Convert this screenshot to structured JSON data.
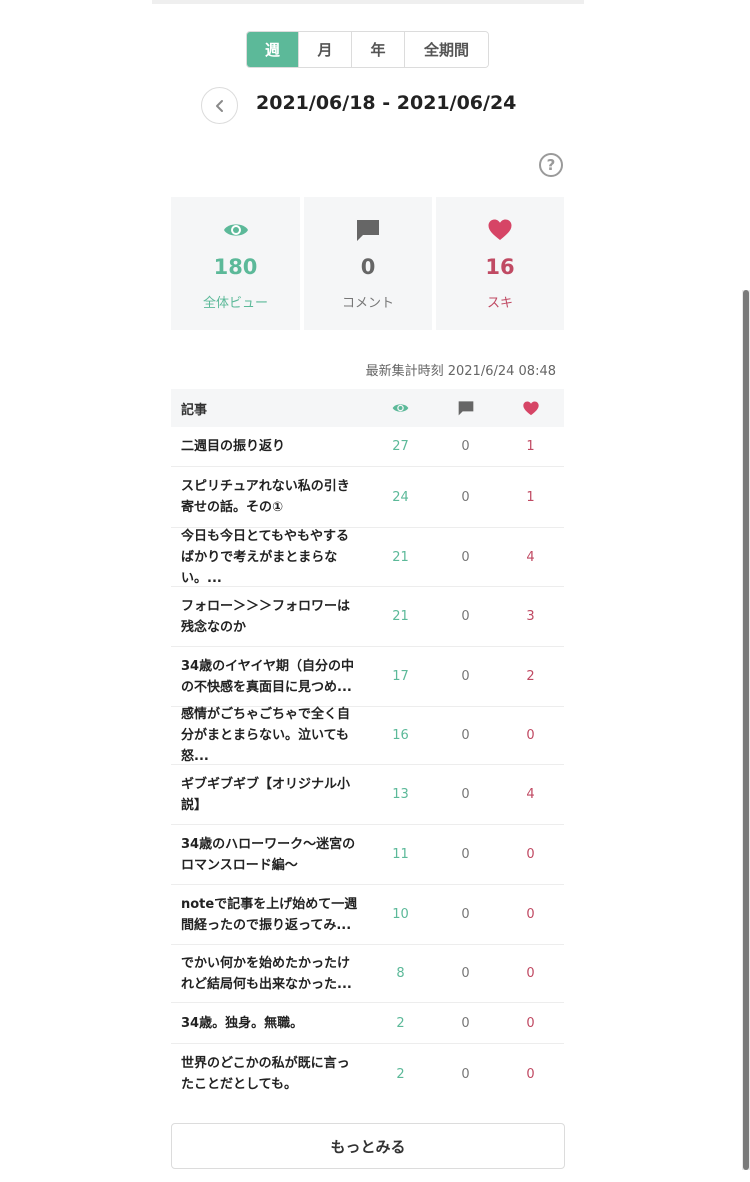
{
  "period_tabs": [
    {
      "label": "週",
      "active": true
    },
    {
      "label": "月",
      "active": false
    },
    {
      "label": "年",
      "active": false
    },
    {
      "label": "全期間",
      "active": false
    }
  ],
  "date_range": "2021/06/18 - 2021/06/24",
  "help_icon_label": "?",
  "stats": {
    "views": {
      "value": "180",
      "label": "全体ビュー",
      "color": "#5cb999"
    },
    "comments": {
      "value": "0",
      "label": "コメント",
      "color": "#666666"
    },
    "likes": {
      "value": "16",
      "label": "スキ",
      "color": "#c04a63"
    }
  },
  "updated": "最新集計時刻 2021/6/24 08:48",
  "table": {
    "header_title": "記事",
    "rows": [
      {
        "title": "二週目の振り返り",
        "views": "27",
        "comments": "0",
        "likes": "1"
      },
      {
        "title": "スピリチュアれない私の引き寄せの話。その①",
        "views": "24",
        "comments": "0",
        "likes": "1"
      },
      {
        "title": "今日も今日とてもやもやするばかりで考えがまとまらない。...",
        "views": "21",
        "comments": "0",
        "likes": "4"
      },
      {
        "title": "フォロー＞＞＞フォロワーは残念なのか",
        "views": "21",
        "comments": "0",
        "likes": "3"
      },
      {
        "title": "34歳のイヤイヤ期（自分の中の不快感を真面目に見つめ...",
        "views": "17",
        "comments": "0",
        "likes": "2"
      },
      {
        "title": "感情がごちゃごちゃで全く自分がまとまらない。泣いても怒...",
        "views": "16",
        "comments": "0",
        "likes": "0"
      },
      {
        "title": "ギブギブギブ【オリジナル小説】",
        "views": "13",
        "comments": "0",
        "likes": "4"
      },
      {
        "title": "34歳のハローワーク〜迷宮のロマンスロード編〜",
        "views": "11",
        "comments": "0",
        "likes": "0"
      },
      {
        "title": "noteで記事を上げ始めて一週間経ったので振り返ってみ...",
        "views": "10",
        "comments": "0",
        "likes": "0"
      },
      {
        "title": "でかい何かを始めたかったけれど結局何も出来なかった...",
        "views": "8",
        "comments": "0",
        "likes": "0"
      },
      {
        "title": "34歳。独身。無職。",
        "views": "2",
        "comments": "0",
        "likes": "0"
      },
      {
        "title": "世界のどこかの私が既に言ったことだとしても。",
        "views": "2",
        "comments": "0",
        "likes": "0"
      }
    ]
  },
  "more_button_label": "もっとみる",
  "colors": {
    "accent": "#5cb999",
    "like": "#c04a63",
    "comment": "#666666"
  }
}
